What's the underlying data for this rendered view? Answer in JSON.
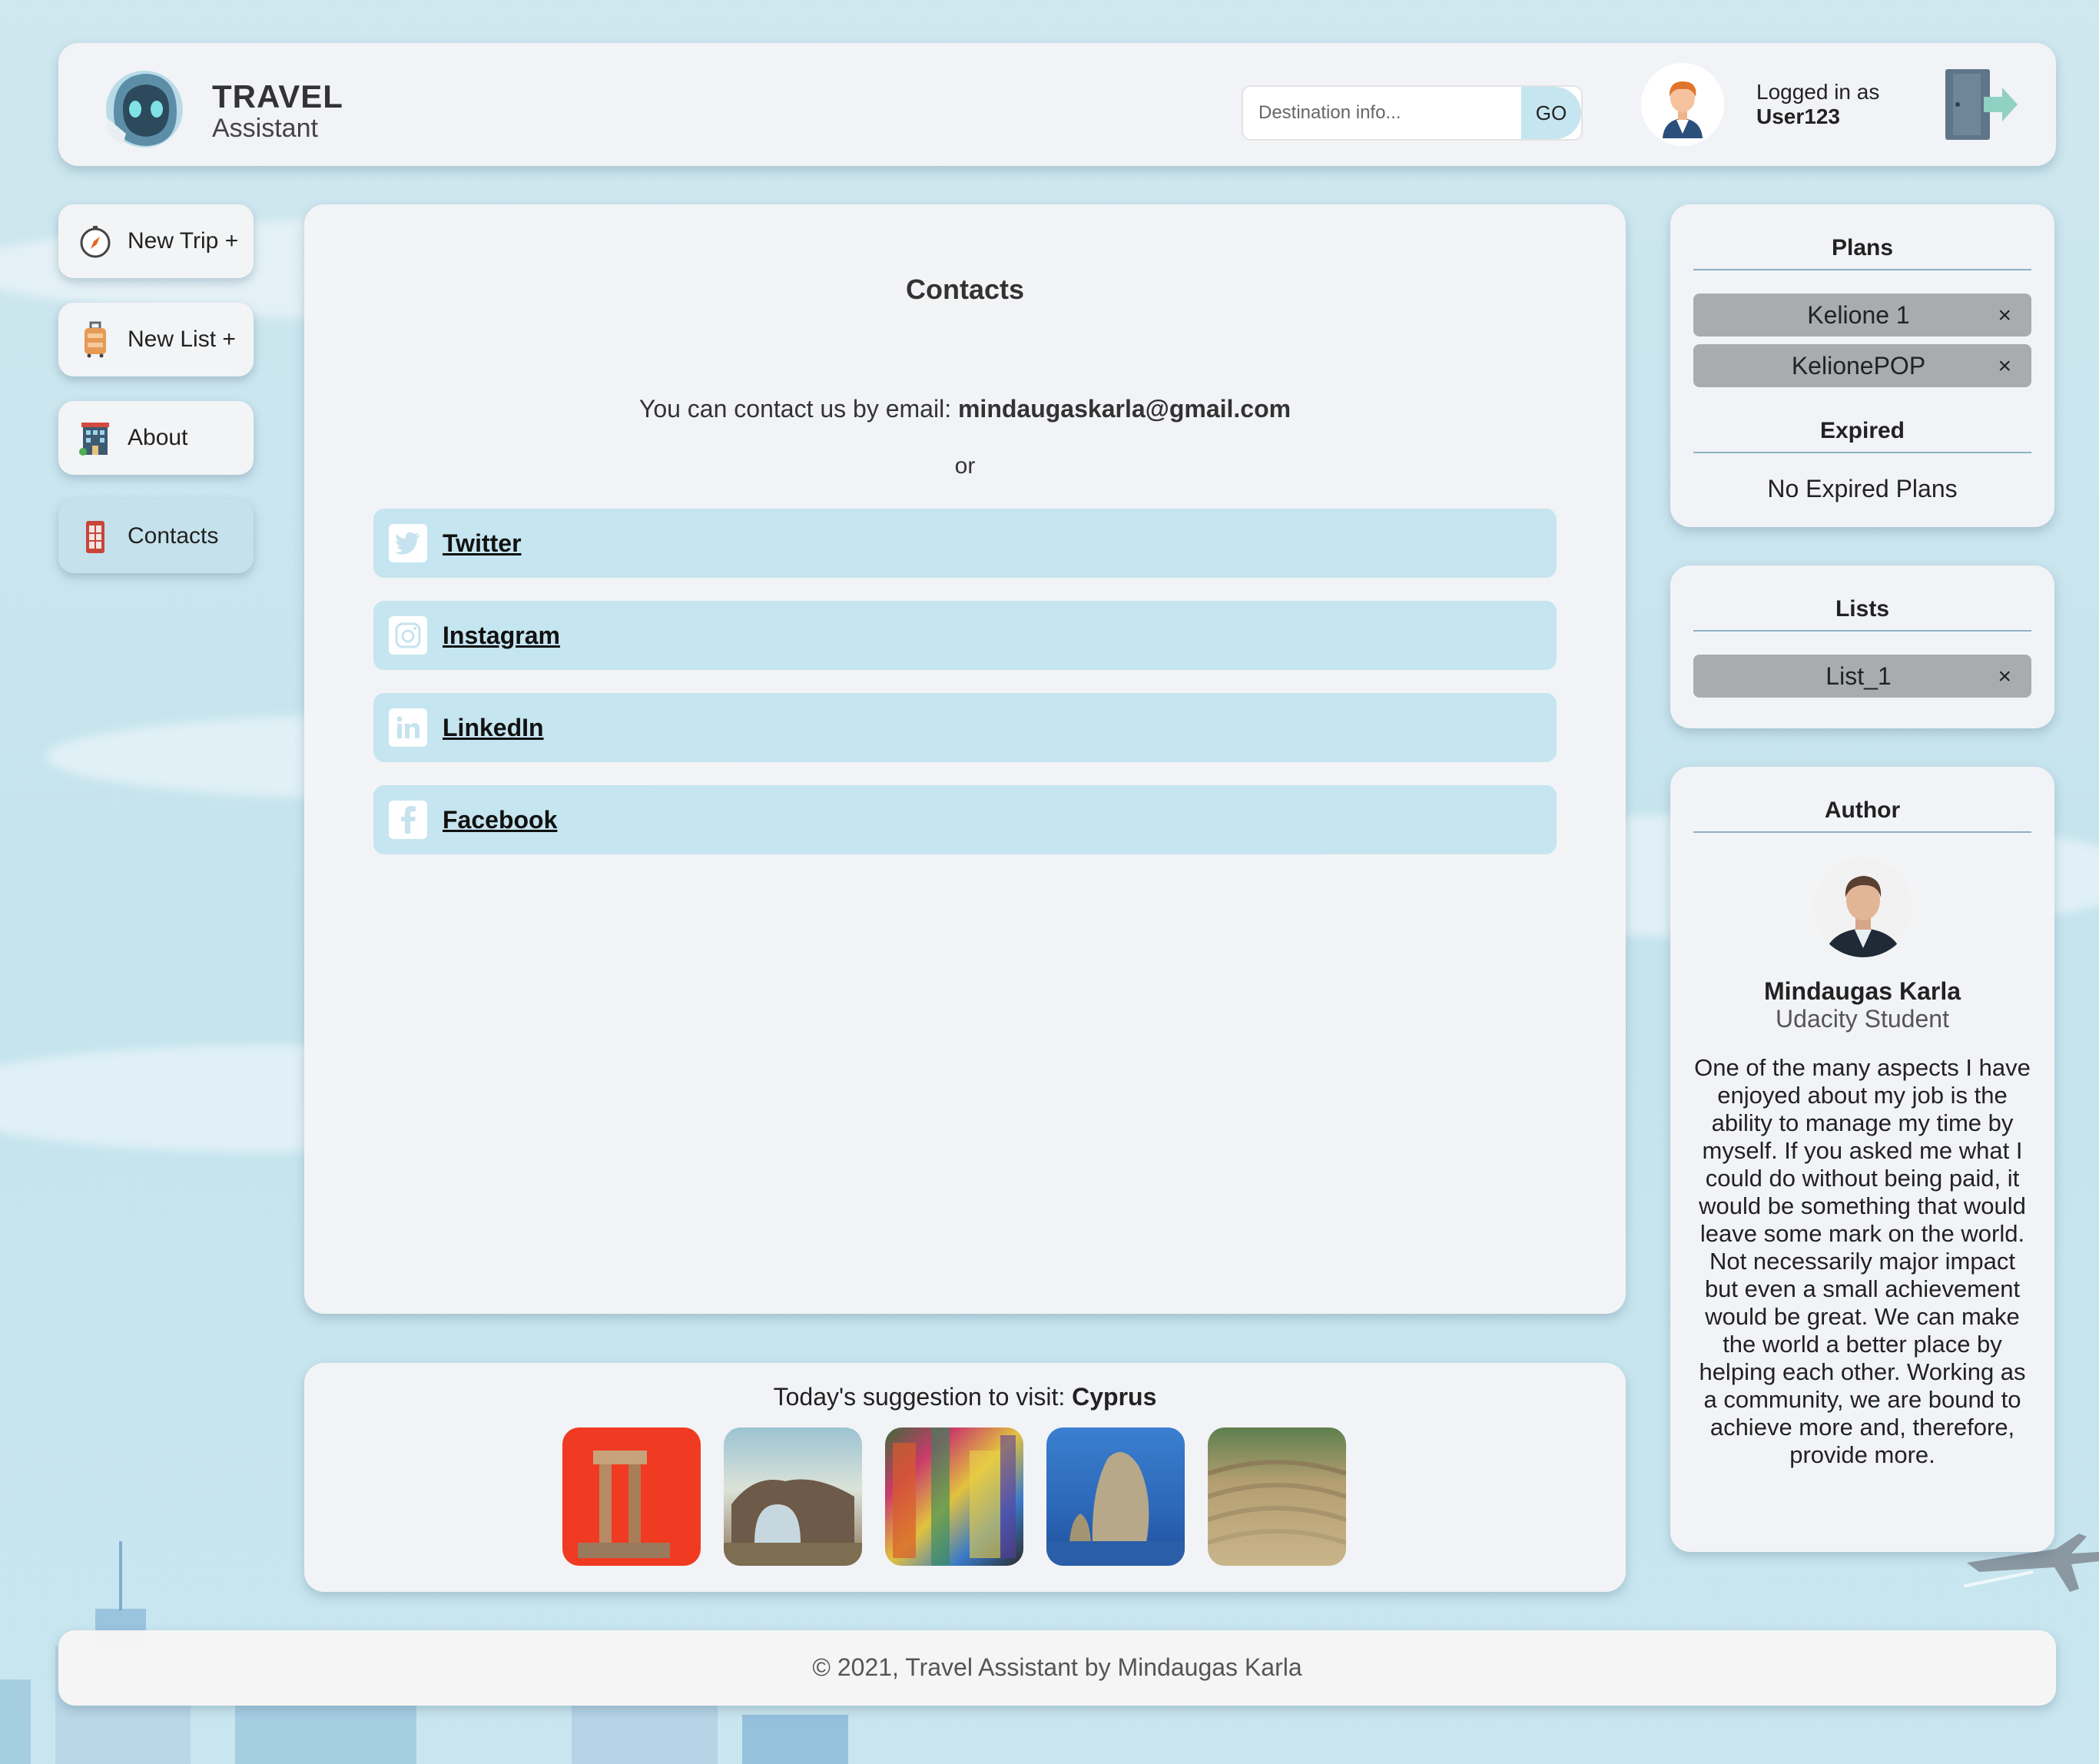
{
  "header": {
    "brand_title": "TRAVEL",
    "brand_subtitle": "Assistant",
    "search_placeholder": "Destination info...",
    "go_label": "GO",
    "logged_in_label": "Logged in as",
    "username": "User123"
  },
  "nav": {
    "items": [
      {
        "label": "New Trip +",
        "icon": "compass-icon"
      },
      {
        "label": "New List +",
        "icon": "luggage-icon"
      },
      {
        "label": "About",
        "icon": "building-icon"
      },
      {
        "label": "Contacts",
        "icon": "phone-booth-icon",
        "active": true
      }
    ]
  },
  "main": {
    "title": "Contacts",
    "email_prefix": "You can contact us by email:",
    "email": "mindaugaskarla@gmail.com",
    "or": "or",
    "social": [
      {
        "label": "Twitter",
        "icon": "twitter-icon"
      },
      {
        "label": "Instagram",
        "icon": "instagram-icon"
      },
      {
        "label": "LinkedIn",
        "icon": "linkedin-icon"
      },
      {
        "label": "Facebook",
        "icon": "facebook-icon"
      }
    ]
  },
  "suggestion": {
    "prefix": "Today's suggestion to visit:",
    "place": "Cyprus"
  },
  "plans": {
    "title": "Plans",
    "items": [
      "Kelione 1",
      "KelionePOP"
    ],
    "remove_symbol": "×",
    "expired_title": "Expired",
    "expired_empty": "No Expired Plans"
  },
  "lists": {
    "title": "Lists",
    "items": [
      "List_1"
    ],
    "remove_symbol": "×"
  },
  "author": {
    "title": "Author",
    "name": "Mindaugas Karla",
    "role": "Udacity Student",
    "bio": "One of the many aspects I have enjoyed about my job is the ability to manage my time by myself. If you asked me what I could do without being paid, it would be something that would leave some mark on the world. Not necessarily major impact but even a small achievement would be great. We can make the world a better place by helping each other. Working as a community, we are bound to achieve more and, therefore, provide more."
  },
  "footer": {
    "text": "© 2021, Travel Assistant by Mindaugas Karla"
  }
}
